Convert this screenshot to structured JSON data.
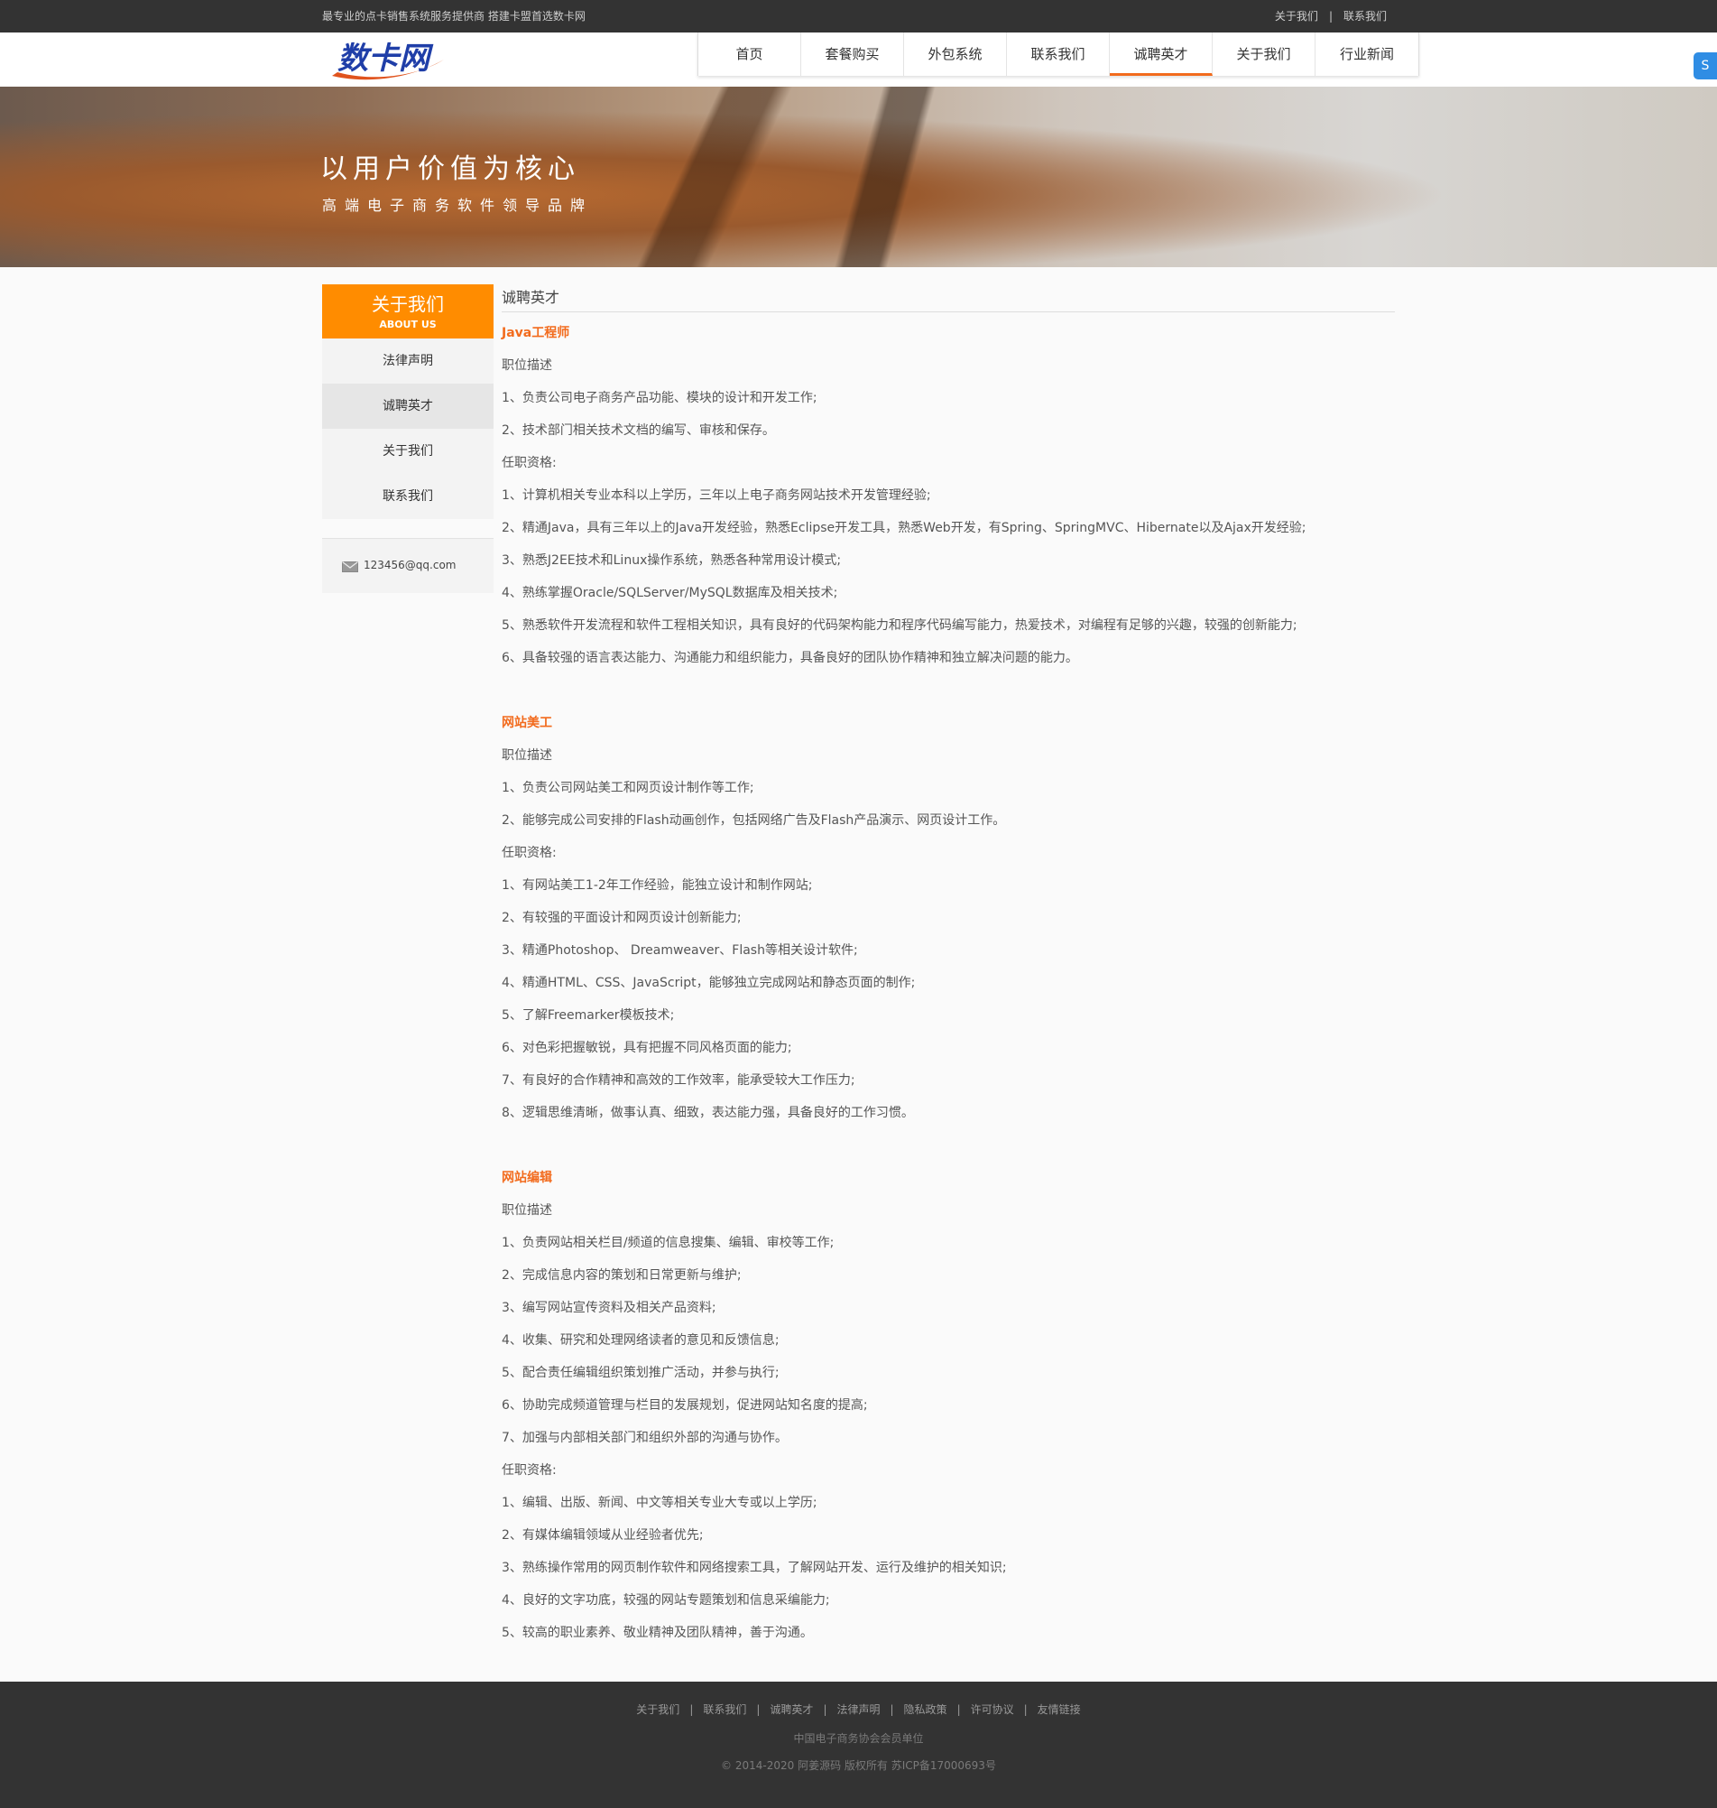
{
  "topbar": {
    "slogan": "最专业的点卡销售系统服务提供商 搭建卡盟首选数卡网",
    "links": [
      "关于我们",
      "联系我们"
    ]
  },
  "logo": {
    "text": "数卡网",
    "colors": {
      "primary": "#1f3ea8",
      "swoosh": "#e0531d"
    }
  },
  "nav": {
    "items": [
      "首页",
      "套餐购买",
      "外包系统",
      "联系我们",
      "诚聘英才",
      "关于我们",
      "行业新闻"
    ],
    "active_index": 4,
    "accent_color": "#f26b1d"
  },
  "float_icon": {
    "name": "service-icon",
    "glyph": "S"
  },
  "banner": {
    "line1": "以用户价值为核心",
    "line2": "高端电子商务软件领导品牌"
  },
  "sidebar": {
    "title_cn": "关于我们",
    "title_en": "ABOUT US",
    "items": [
      "法律声明",
      "诚聘英才",
      "关于我们",
      "联系我们"
    ],
    "active_index": 1,
    "email": "123456@qq.com",
    "head_color": "#ff8c00"
  },
  "content": {
    "title": "诚聘英才",
    "jobs": [
      {
        "title": "Java工程师",
        "lines": [
          "职位描述",
          "1、负责公司电子商务产品功能、模块的设计和开发工作;",
          "2、技术部门相关技术文档的编写、审核和保存。",
          "任职资格:",
          "1、计算机相关专业本科以上学历，三年以上电子商务网站技术开发管理经验;",
          "2、精通Java，具有三年以上的Java开发经验，熟悉Eclipse开发工具，熟悉Web开发，有Spring、SpringMVC、Hibernate以及Ajax开发经验;",
          "3、熟悉J2EE技术和Linux操作系统，熟悉各种常用设计模式;",
          "4、熟练掌握Oracle/SQLServer/MySQL数据库及相关技术;",
          "5、熟悉软件开发流程和软件工程相关知识，具有良好的代码架构能力和程序代码编写能力，热爱技术，对编程有足够的兴趣，较强的创新能力;",
          "6、具备较强的语言表达能力、沟通能力和组织能力，具备良好的团队协作精神和独立解决问题的能力。"
        ]
      },
      {
        "title": "网站美工",
        "lines": [
          "职位描述",
          "1、负责公司网站美工和网页设计制作等工作;",
          "2、能够完成公司安排的Flash动画创作，包括网络广告及Flash产品演示、网页设计工作。",
          "任职资格:",
          "1、有网站美工1-2年工作经验，能独立设计和制作网站;",
          "2、有较强的平面设计和网页设计创新能力;",
          "3、精通Photoshop、 Dreamweaver、Flash等相关设计软件;",
          "4、精通HTML、CSS、JavaScript，能够独立完成网站和静态页面的制作;",
          "5、了解Freemarker模板技术;",
          "6、对色彩把握敏锐，具有把握不同风格页面的能力;",
          "7、有良好的合作精神和高效的工作效率，能承受较大工作压力;",
          "8、逻辑思维清晰，做事认真、细致，表达能力强，具备良好的工作习惯。"
        ]
      },
      {
        "title": "网站编辑",
        "lines": [
          "职位描述",
          "1、负责网站相关栏目/频道的信息搜集、编辑、审校等工作;",
          "2、完成信息内容的策划和日常更新与维护;",
          "3、编写网站宣传资料及相关产品资料;",
          "4、收集、研究和处理网络读者的意见和反馈信息;",
          "5、配合责任编辑组织策划推广活动，并参与执行;",
          "6、协助完成频道管理与栏目的发展规划，促进网站知名度的提高;",
          "7、加强与内部相关部门和组织外部的沟通与协作。",
          "任职资格:",
          "1、编辑、出版、新闻、中文等相关专业大专或以上学历;",
          "2、有媒体编辑领域从业经验者优先;",
          "3、熟练操作常用的网页制作软件和网络搜索工具，了解网站开发、运行及维护的相关知识;",
          "4、良好的文字功底，较强的网站专题策划和信息采编能力;",
          "5、较高的职业素养、敬业精神及团队精神，善于沟通。"
        ]
      }
    ]
  },
  "footer": {
    "links": [
      "关于我们",
      "联系我们",
      "诚聘英才",
      "法律声明",
      "隐私政策",
      "许可协议",
      "友情链接"
    ],
    "member": "中国电子商务协会会员单位",
    "copyright": "© 2014-2020 阿姜源码 版权所有 苏ICP备17000693号"
  }
}
